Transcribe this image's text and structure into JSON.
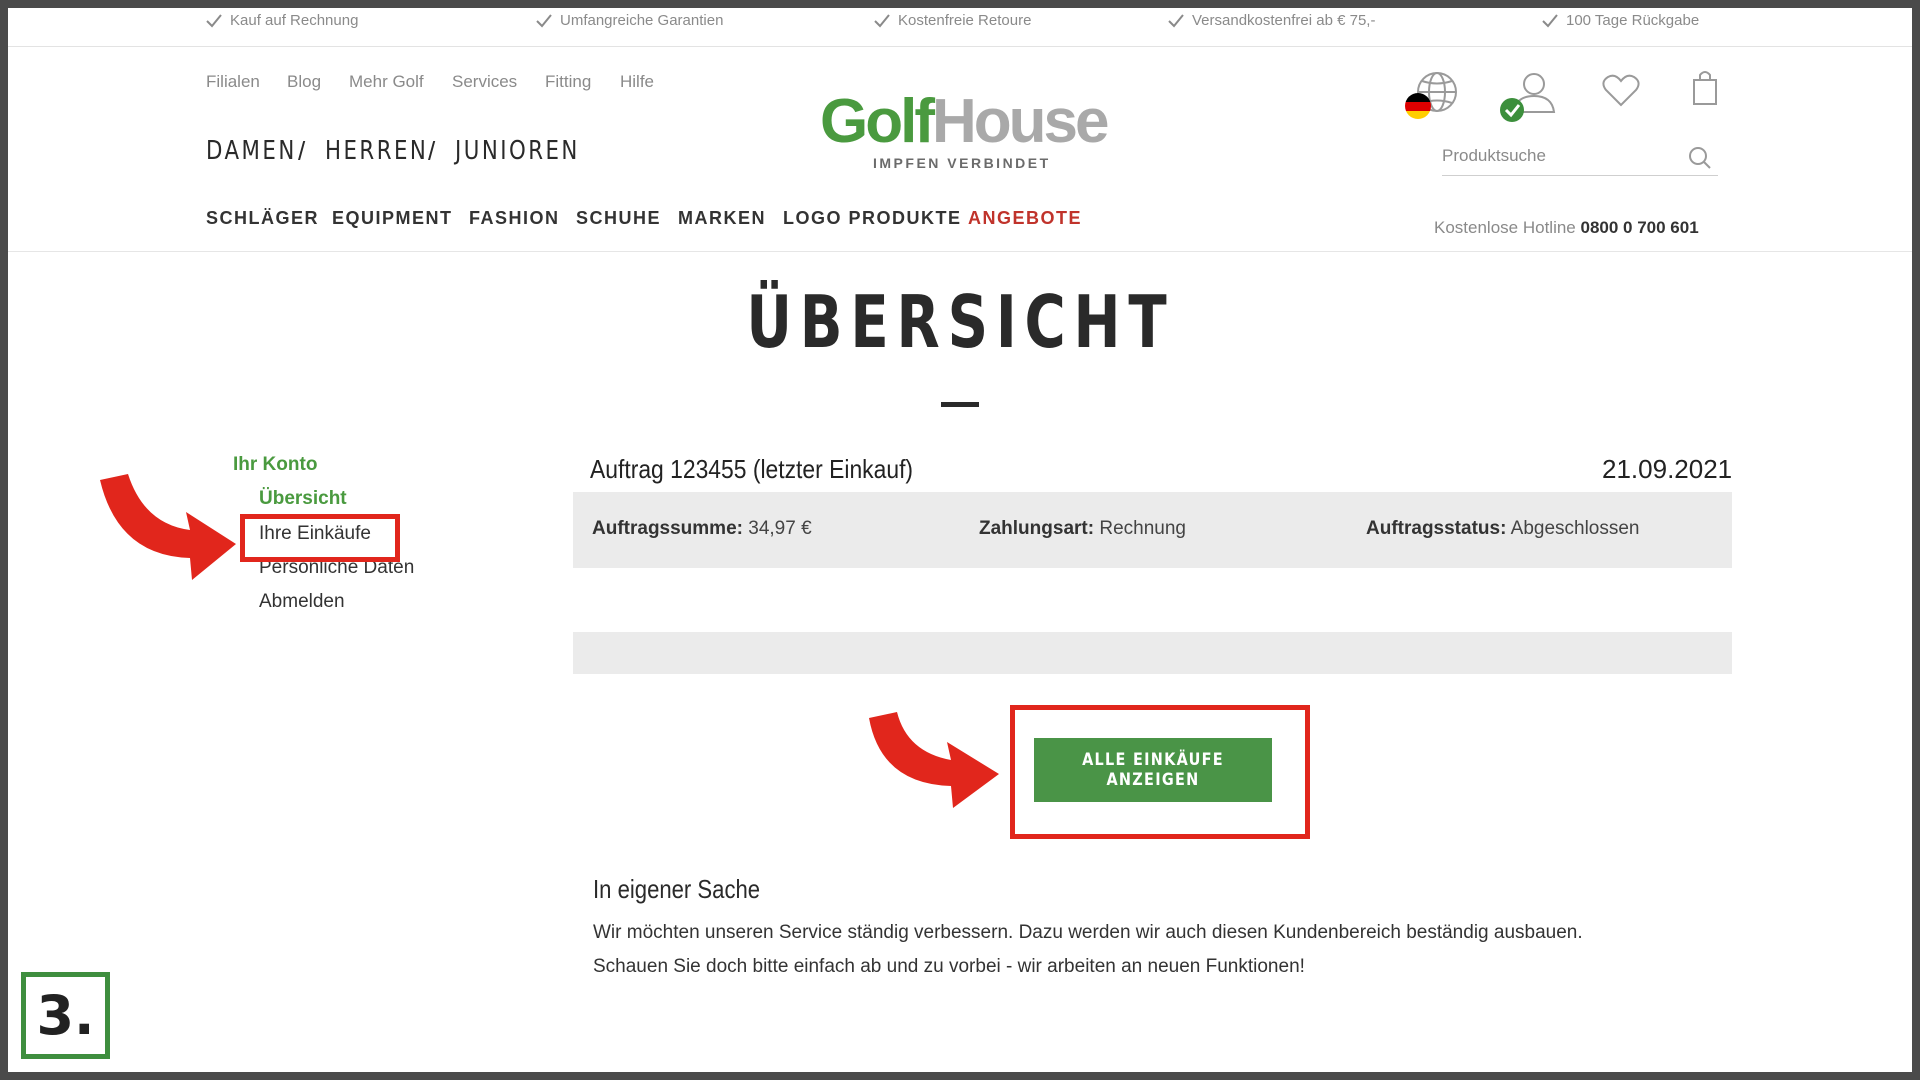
{
  "usp_bar": [
    "Kauf auf Rechnung",
    "Umfangreiche Garantien",
    "Kostenfreie Retoure",
    "Versandkostenfrei ab € 75,-",
    "100 Tage Rückgabe"
  ],
  "utility_nav": [
    "Filialen",
    "Blog",
    "Mehr Golf",
    "Services",
    "Fitting",
    "Hilfe"
  ],
  "gender_nav": [
    "DAMEN",
    "HERREN",
    "JUNIOREN"
  ],
  "gender_separator": "/",
  "main_nav": [
    "SCHLÄGER",
    "EQUIPMENT",
    "FASHION",
    "SCHUHE",
    "MARKEN",
    "LOGO PRODUKTE",
    "ANGEBOTE"
  ],
  "logo": {
    "part1": "Golf",
    "part2": "House",
    "tagline": "IMPFEN VERBINDET"
  },
  "search": {
    "placeholder": "Produktsuche"
  },
  "hotline": {
    "label": "Kostenlose Hotline",
    "number": "0800 0 700 601"
  },
  "page_title": "ÜBERSICHT",
  "sidebar": {
    "heading": "Ihr Konto",
    "items": [
      "Übersicht",
      "Ihre Einkäufe",
      "Persönliche Daten",
      "Abmelden"
    ]
  },
  "order": {
    "title": "Auftrag 123455 (letzter Einkauf)",
    "date": "21.09.2021",
    "sum_label": "Auftragssumme:",
    "sum_value": "34,97 €",
    "payment_label": "Zahlungsart:",
    "payment_value": "Rechnung",
    "status_label": "Auftragsstatus:",
    "status_value": "Abgeschlossen"
  },
  "all_purchases_button": "ALLE EINKÄUFE ANZEIGEN",
  "own_matter": {
    "title": "In eigener Sache",
    "line1": "Wir möchten unseren Service ständig verbessern. Dazu werden wir auch diesen Kundenbereich beständig ausbauen.",
    "line2": "Schauen Sie doch bitte einfach ab und zu vorbei - wir arbeiten an neuen Funktionen!"
  },
  "step_badge": "3.",
  "colors": {
    "brand_green": "#4a9a3f",
    "button_green": "#4a9447",
    "offer_red": "#c0332b",
    "annotation_red": "#e1261c"
  }
}
